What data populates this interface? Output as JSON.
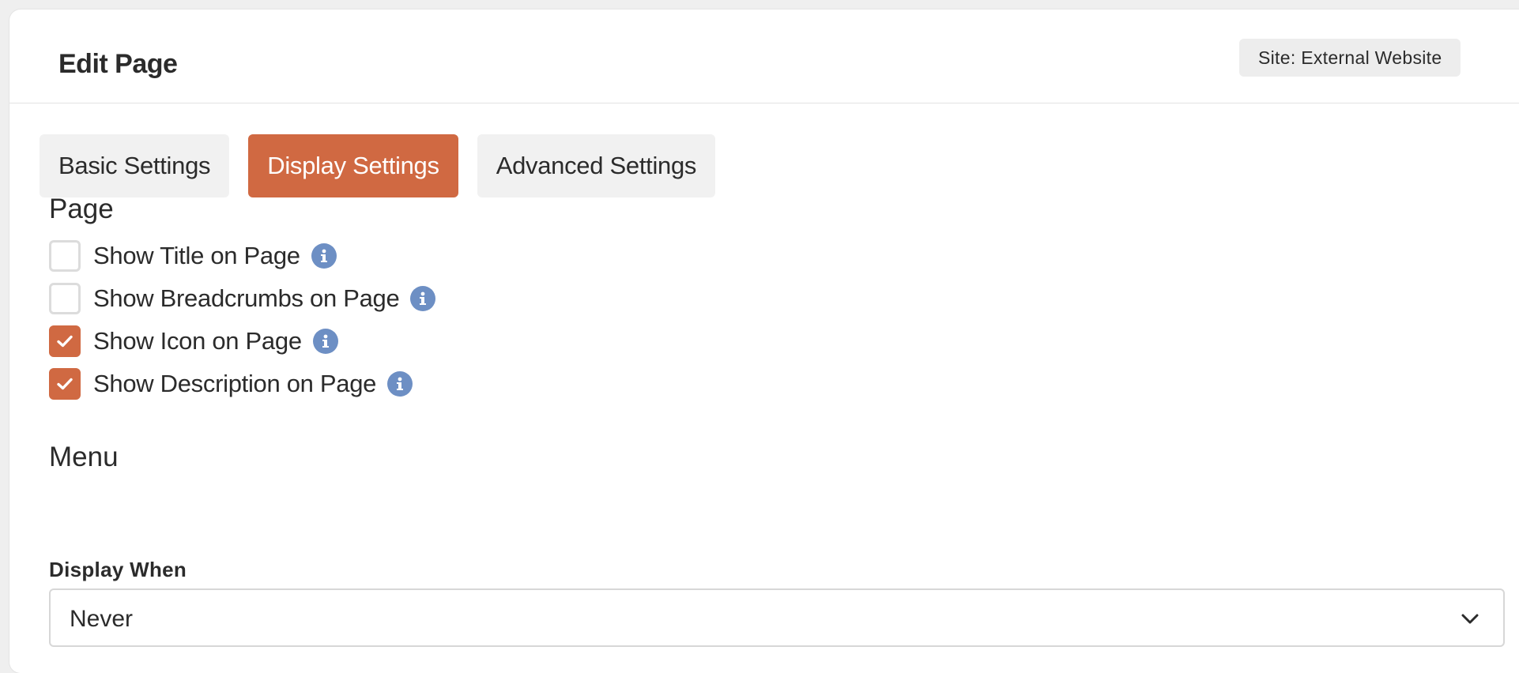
{
  "header": {
    "title": "Edit Page",
    "site_badge": "Site: External Website"
  },
  "tabs": [
    {
      "label": "Basic Settings",
      "active": false
    },
    {
      "label": "Display Settings",
      "active": true
    },
    {
      "label": "Advanced Settings",
      "active": false
    }
  ],
  "page_section": {
    "heading": "Page",
    "options": [
      {
        "label": "Show Title on Page",
        "checked": false,
        "icon": "info-icon"
      },
      {
        "label": "Show Breadcrumbs on Page",
        "checked": false,
        "icon": "info-icon"
      },
      {
        "label": "Show Icon on Page",
        "checked": true,
        "icon": "info-icon"
      },
      {
        "label": "Show Description on Page",
        "checked": true,
        "icon": "info-icon"
      }
    ]
  },
  "menu_section": {
    "heading": "Menu",
    "display_when": {
      "label": "Display When",
      "value": "Never",
      "icon": "chevron-down-icon"
    }
  },
  "colors": {
    "accent": "#d06942",
    "info": "#6d8fc4",
    "tab_inactive_bg": "#f1f1f1",
    "badge_bg": "#ededed"
  }
}
